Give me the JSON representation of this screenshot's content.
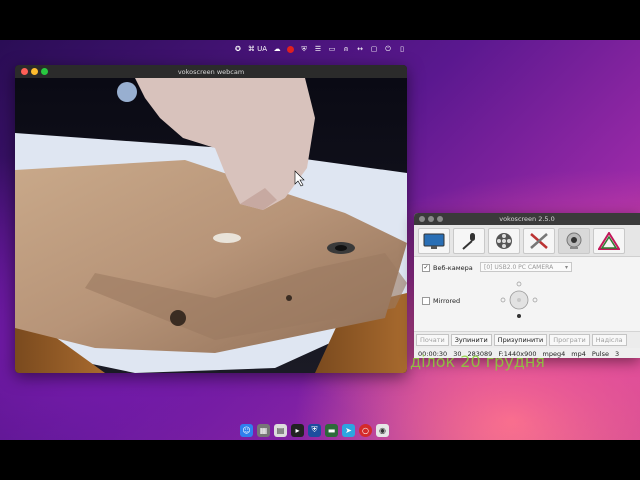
{
  "top_panel": {
    "keyboard_layout": "⌘ UA",
    "icons": [
      "app-icon",
      "cloud-icon",
      "record-icon",
      "shield-icon",
      "list-icon",
      "folder-icon",
      "bell-icon",
      "link-icon",
      "lock-icon",
      "power-icon",
      "status-icon"
    ]
  },
  "webcam_window": {
    "title": "vokoscreen webcam"
  },
  "voko_window": {
    "title": "vokoscreen 2.5.0",
    "tabs": [
      "screen-tab",
      "microphone-tab",
      "video-tab",
      "tools-tab",
      "webcam-tab",
      "about-tab"
    ],
    "webcam_checkbox_label": "Веб-камера",
    "webcam_checked": true,
    "camera_select_value": "[0] USB2.0 PC CAMERA",
    "mirrored_label": "Mirrored",
    "mirrored_checked": false,
    "buttons": [
      "Почати",
      "Зупинити",
      "Призупинити",
      "Програти",
      "Надісла"
    ],
    "status": {
      "time": "00:00:30",
      "fps": "30",
      "size": "283089",
      "format": "F:1440x900",
      "codec": "mpeg4",
      "container": "mp4",
      "audio": "Pulse",
      "extra": "3"
    }
  },
  "date_text": "ділок 20 грудня",
  "dock": {
    "apps": [
      "finder-icon",
      "calculator-icon",
      "text-editor-icon",
      "terminal-icon",
      "security-icon",
      "monitor-icon",
      "telegram-icon",
      "opera-icon",
      "camera-icon"
    ]
  },
  "colors": {
    "accent_date": "#8ad03a",
    "record_red": "#e02020"
  }
}
